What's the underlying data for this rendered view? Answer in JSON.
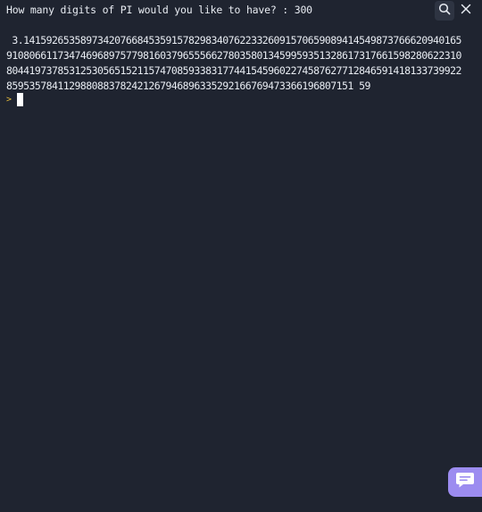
{
  "console": {
    "prompt_text": "How many digits of PI would you like to have? : 300",
    "output_lines": [
      " 3.14159265358973420766845359157829834076223326091570659089414549873766620940165",
      "91080661173474696897577981603796555662780358013459959351328617317661598280622310",
      "80441973785312530565152115747085933831774415459602274587627712846591418133739922",
      "8595357841129880883782421267946896335292166769473366196807151 59"
    ],
    "input_prompt_symbol": ">"
  },
  "toolbar": {
    "search_icon": "search-icon",
    "close_icon": "close-icon"
  },
  "chat": {
    "icon": "chat-icon",
    "color": "#9c8cf0"
  },
  "colors": {
    "background": "#1f2430",
    "text": "#e8ecf2",
    "prompt_symbol": "#e2b93b"
  }
}
